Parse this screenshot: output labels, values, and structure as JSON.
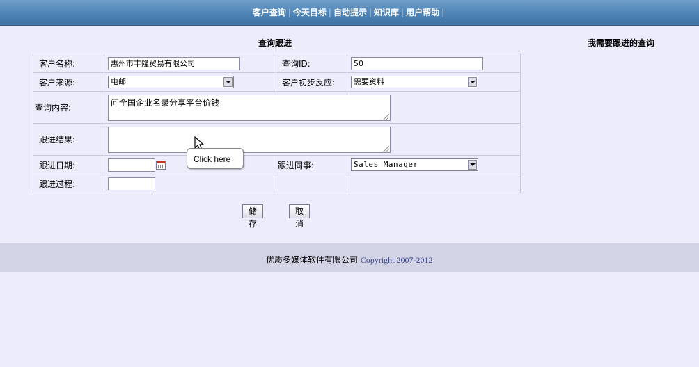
{
  "nav": {
    "items": [
      "客户查询",
      "今天目标",
      "自动提示",
      "知识库",
      "用户帮助"
    ],
    "separator": "|"
  },
  "page_title": "查询跟进",
  "side_title": "我需要跟进的查询",
  "form": {
    "customer_name": {
      "label": "客户名称:",
      "value": "惠州市丰隆贸易有限公司"
    },
    "inquiry_id": {
      "label": "查询ID:",
      "value": "50"
    },
    "customer_source": {
      "label": "客户来源:",
      "value": "电邮"
    },
    "initial_reaction": {
      "label": "客户初步反应:",
      "value": "需要资料"
    },
    "inquiry_content": {
      "label": "查询内容:",
      "value": "问全国企业名录分享平台价钱"
    },
    "follow_result": {
      "label": "跟进结果:",
      "value": ""
    },
    "follow_date": {
      "label": "跟进日期:",
      "value": ""
    },
    "colleague": {
      "label": "跟进同事:",
      "value": "Sales Manager"
    },
    "follow_process": {
      "label": "跟进过程:",
      "value": ""
    }
  },
  "buttons": {
    "save": "储存",
    "cancel": "取消"
  },
  "footer": {
    "company": "优质多媒体软件有限公司",
    "copyright": "Copyright 2007-2012"
  },
  "tooltip": {
    "text": "Click here"
  },
  "colors": {
    "nav_bar": "#4e84b6",
    "background": "#ececfb",
    "footer": "#d3d3e6"
  }
}
